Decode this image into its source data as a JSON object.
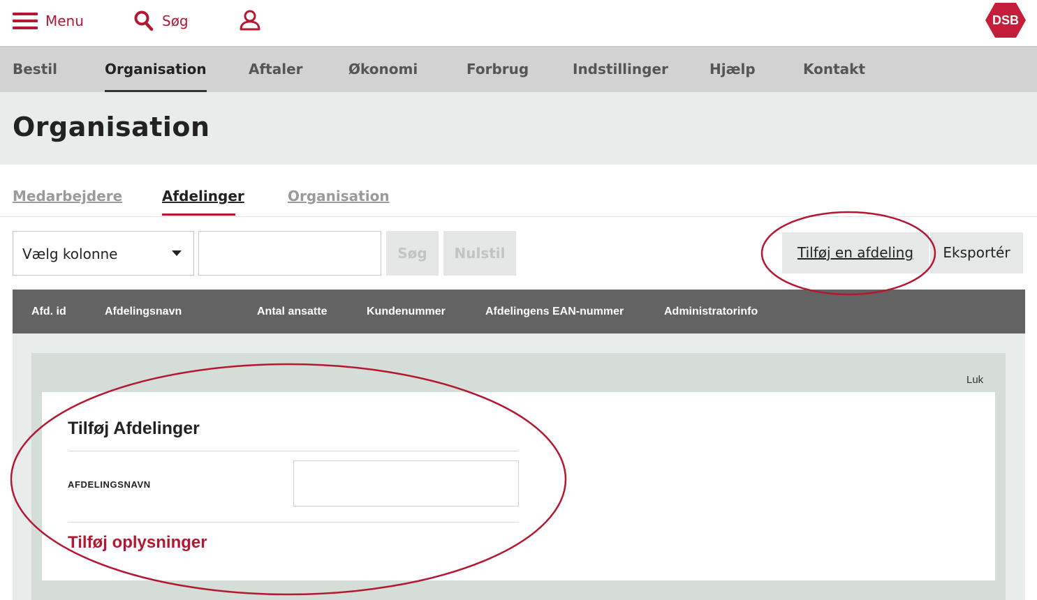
{
  "topbar": {
    "menu_label": "Menu",
    "search_label": "Søg",
    "logo_text": "DSB"
  },
  "nav": {
    "items": [
      {
        "label": "Bestil"
      },
      {
        "label": "Organisation",
        "active": true
      },
      {
        "label": "Aftaler"
      },
      {
        "label": "Økonomi"
      },
      {
        "label": "Forbrug"
      },
      {
        "label": "Indstillinger"
      },
      {
        "label": "Hjælp"
      },
      {
        "label": "Kontakt"
      }
    ]
  },
  "page": {
    "title": "Organisation"
  },
  "subtabs": {
    "items": [
      {
        "label": "Medarbejdere"
      },
      {
        "label": "Afdelinger",
        "active": true
      },
      {
        "label": "Organisation"
      }
    ]
  },
  "filter": {
    "column_select_value": "Vælg kolonne",
    "search_value": "",
    "search_button": "Søg",
    "reset_button": "Nulstil",
    "add_button": "Tilføj en afdeling",
    "export_button": "Eksportér"
  },
  "table": {
    "columns": [
      "Afd. id",
      "Afdelingsnavn",
      "Antal ansatte",
      "Kundenummer",
      "Afdelingens EAN-nummer",
      "Administratorinfo"
    ]
  },
  "panel": {
    "close_label": "Luk",
    "title": "Tilføj Afdelinger",
    "field_label": "AFDELINGSNAVN",
    "field_value": "",
    "add_info_label": "Tilføj oplysninger"
  },
  "colors": {
    "brand_red": "#b41730",
    "nav_bg": "#d2d2d2",
    "header_bg": "#e8ecea",
    "table_head_bg": "#636363"
  }
}
